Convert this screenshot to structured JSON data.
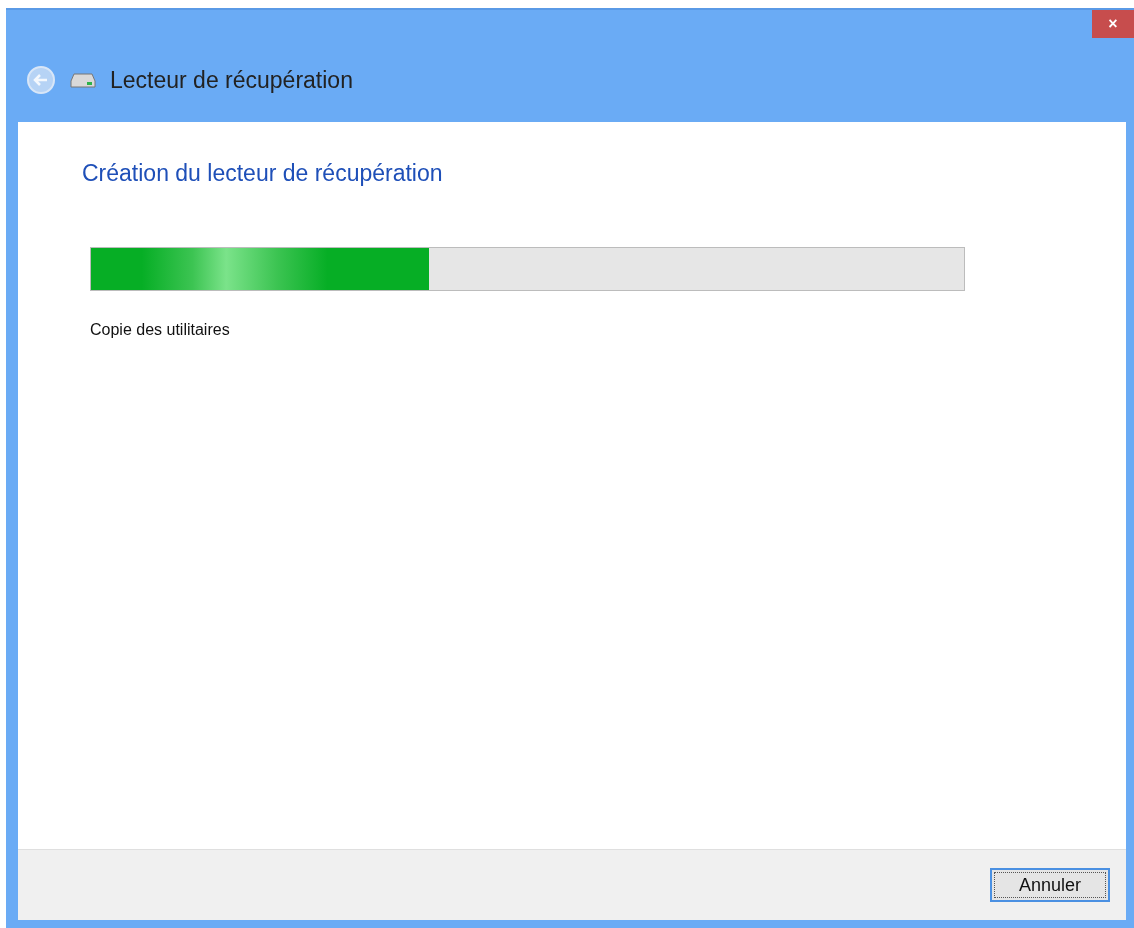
{
  "window": {
    "close": "×",
    "title": "Lecteur de récupération"
  },
  "heading": "Création du lecteur de récupération",
  "progress": {
    "level": 0.387
  },
  "status": "Copie des utilitaires",
  "buttons": [
    "Annuler"
  ]
}
